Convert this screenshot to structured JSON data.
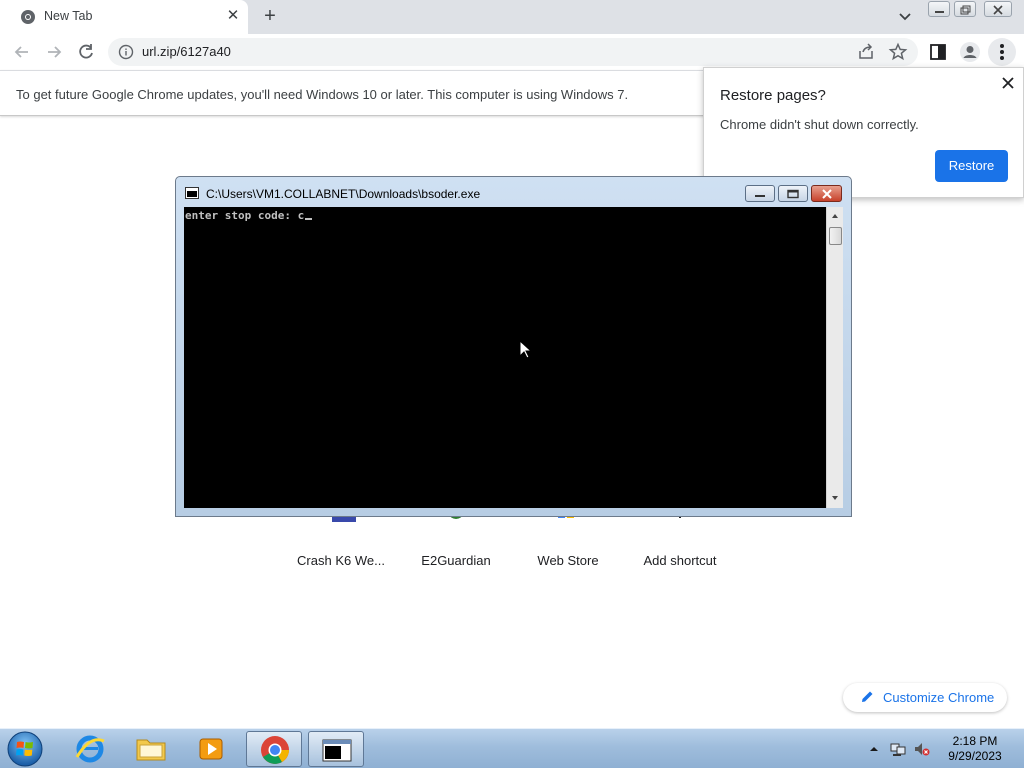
{
  "browser": {
    "tab_title": "New Tab",
    "url": "url.zip/6127a40",
    "infobar_text": "To get future Google Chrome updates, you'll need Windows 10 or later. This computer is using Windows 7."
  },
  "restore_popup": {
    "title": "Restore pages?",
    "message": "Chrome didn't shut down correctly.",
    "button": "Restore"
  },
  "console": {
    "title": "C:\\Users\\VM1.COLLABNET\\Downloads\\bsoder.exe",
    "prompt": "enter stop code: c"
  },
  "shortcuts": [
    {
      "label": "Crash K6 We..."
    },
    {
      "label": "E2Guardian"
    },
    {
      "label": "Web Store"
    },
    {
      "label": "Add shortcut"
    }
  ],
  "customize_label": "Customize Chrome",
  "taskbar": {
    "time": "2:18 PM",
    "date": "9/29/2023",
    "apps": [
      "internet-explorer",
      "file-explorer",
      "media-player",
      "chrome",
      "console"
    ]
  },
  "colors": {
    "accent": "#1a73e8",
    "console_bg": "#000000",
    "console_text": "#c0c0c0"
  }
}
